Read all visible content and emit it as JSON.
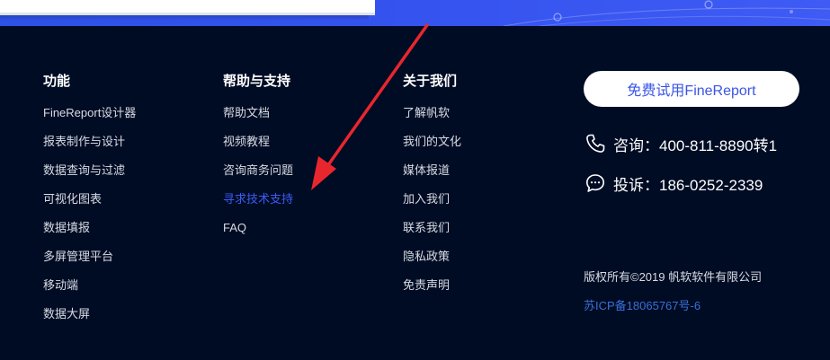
{
  "colors": {
    "background": "#000c24",
    "banner_blue": "#3553ef",
    "link_active": "#3b5cf5",
    "icp_link": "#3b6fd8",
    "annotation_arrow": "#e8262e"
  },
  "columns": {
    "features": {
      "title": "功能",
      "items": [
        {
          "label": "FineReport设计器"
        },
        {
          "label": "报表制作与设计"
        },
        {
          "label": "数据查询与过滤"
        },
        {
          "label": "可视化图表"
        },
        {
          "label": "数据填报"
        },
        {
          "label": "多屏管理平台"
        },
        {
          "label": "移动端"
        },
        {
          "label": "数据大屏"
        }
      ]
    },
    "help": {
      "title": "帮助与支持",
      "items": [
        {
          "label": "帮助文档"
        },
        {
          "label": "视频教程"
        },
        {
          "label": "咨询商务问题"
        },
        {
          "label": "寻求技术支持",
          "active": true
        },
        {
          "label": "FAQ"
        }
      ]
    },
    "about": {
      "title": "关于我们",
      "items": [
        {
          "label": "了解帆软"
        },
        {
          "label": "我们的文化"
        },
        {
          "label": "媒体报道"
        },
        {
          "label": "加入我们"
        },
        {
          "label": "联系我们"
        },
        {
          "label": "隐私政策"
        },
        {
          "label": "免责声明"
        }
      ]
    }
  },
  "trial_button": {
    "label": "免费试用FineReport"
  },
  "contact": {
    "phone": {
      "icon": "phone-icon",
      "text": "咨询：400-811-8890转1"
    },
    "complaint": {
      "icon": "chat-bubble-icon",
      "text": "投诉：186-0252-2339"
    }
  },
  "footer": {
    "copyright": "版权所有©2019 帆软软件有限公司",
    "icp": "苏ICP备18065767号-6"
  }
}
